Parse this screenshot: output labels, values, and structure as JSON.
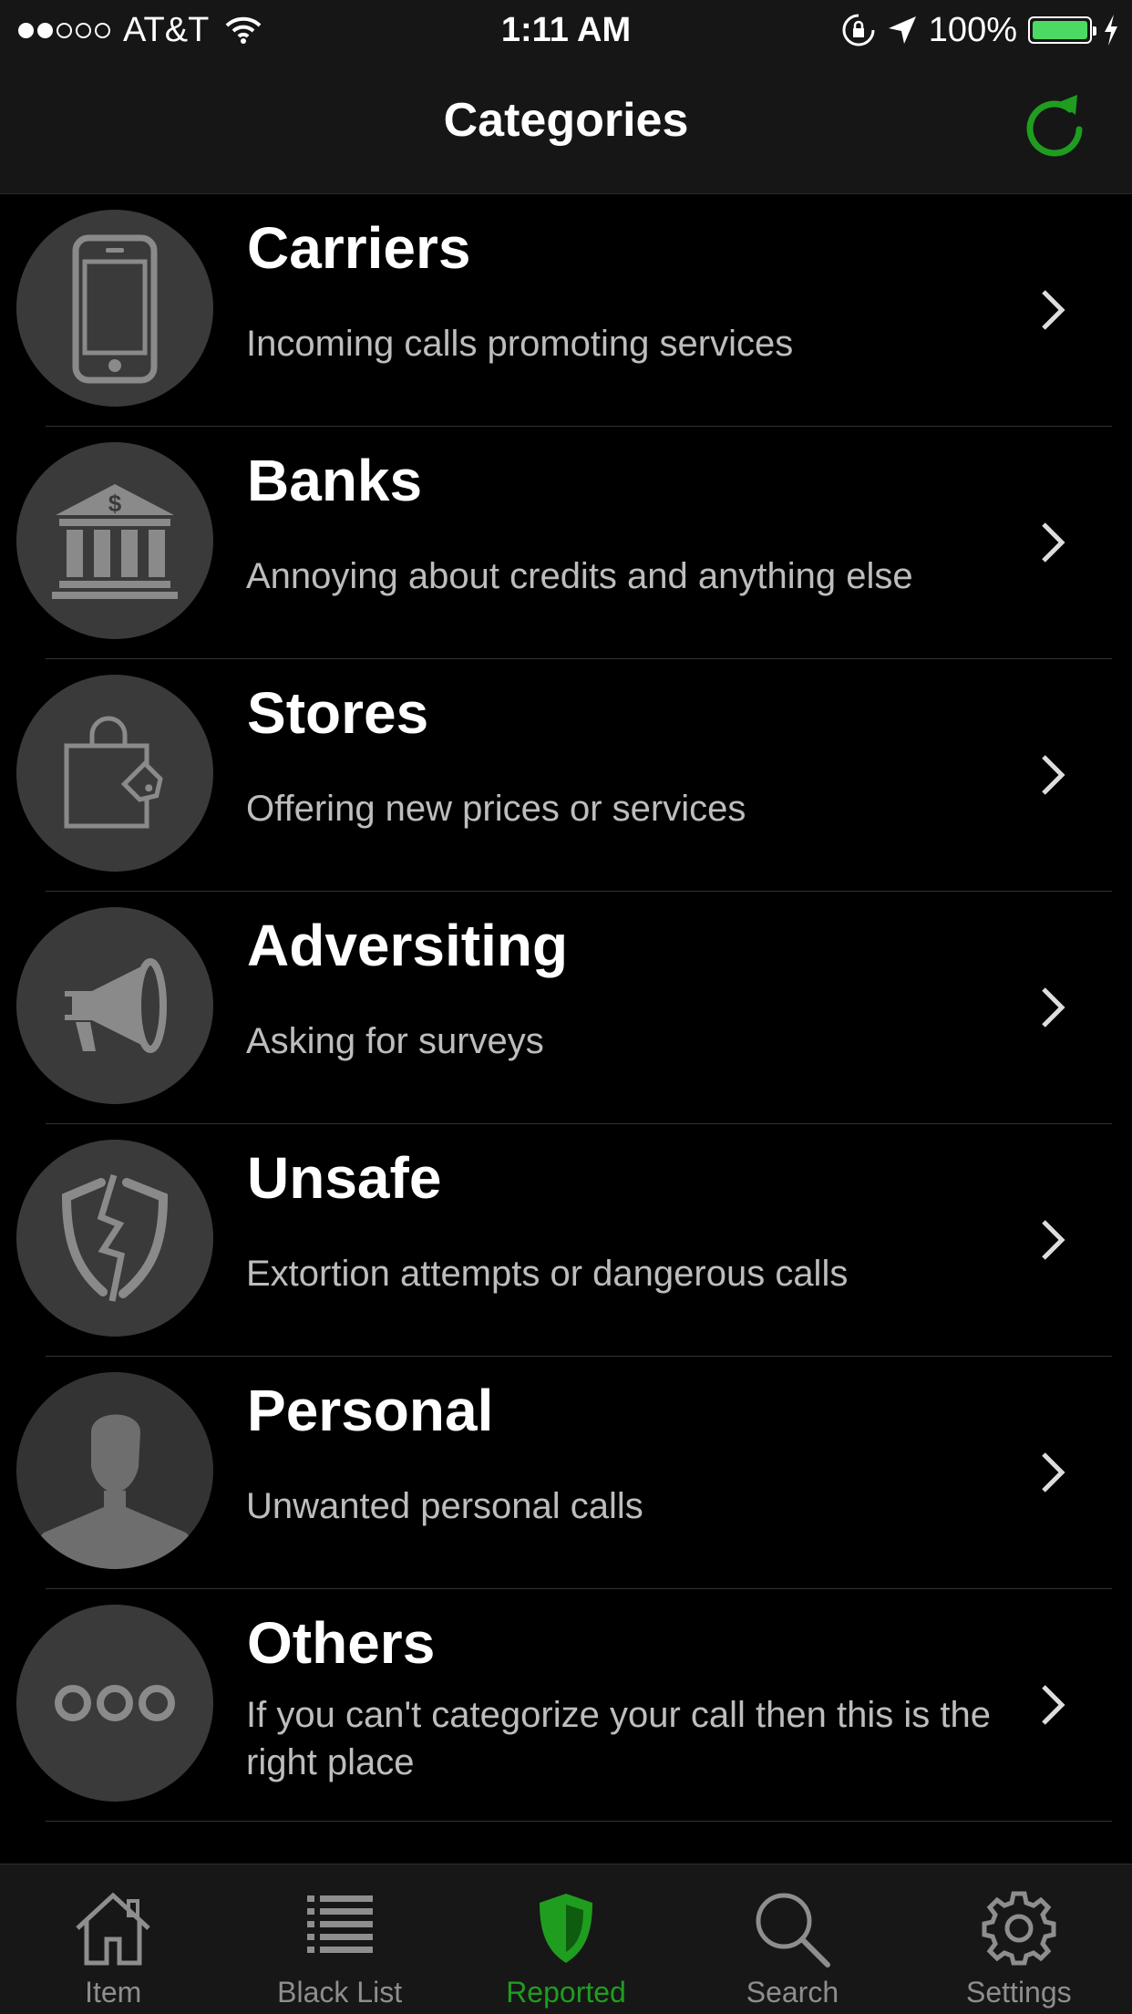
{
  "status_bar": {
    "carrier": "AT&T",
    "time": "1:11 AM",
    "battery": "100%"
  },
  "nav": {
    "title": "Categories"
  },
  "categories": [
    {
      "title": "Carriers",
      "subtitle": "Incoming calls promoting services",
      "icon": "phone-icon"
    },
    {
      "title": "Banks",
      "subtitle": "Annoying about credits and anything else",
      "icon": "bank-icon"
    },
    {
      "title": "Stores",
      "subtitle": "Offering new prices or services",
      "icon": "shopping-bag-icon"
    },
    {
      "title": "Adversiting",
      "subtitle": "Asking for surveys",
      "icon": "megaphone-icon"
    },
    {
      "title": "Unsafe",
      "subtitle": "Extortion attempts or dangerous calls",
      "icon": "broken-shield-icon"
    },
    {
      "title": "Personal",
      "subtitle": "Unwanted personal calls",
      "icon": "person-silhouette-icon"
    },
    {
      "title": "Others",
      "subtitle": "If you can't categorize your call then this is the right place",
      "icon": "three-circles-icon"
    }
  ],
  "tabs": [
    {
      "label": "Item",
      "icon": "home-icon",
      "active": false
    },
    {
      "label": "Black List",
      "icon": "list-icon",
      "active": false
    },
    {
      "label": "Reported",
      "icon": "shield-icon",
      "active": true
    },
    {
      "label": "Search",
      "icon": "search-icon",
      "active": false
    },
    {
      "label": "Settings",
      "icon": "gear-icon",
      "active": false
    }
  ],
  "colors": {
    "accent": "#1f9d1f",
    "background": "#000000",
    "icon_circle": "#3a3a3a",
    "icon_glyph": "#8a8a8a"
  }
}
